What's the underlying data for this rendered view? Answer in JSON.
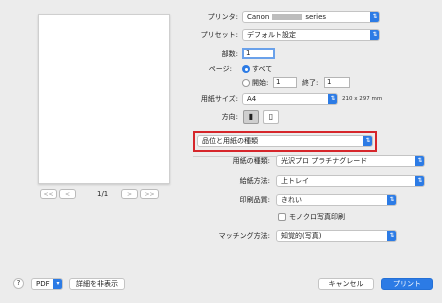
{
  "preview": {
    "page_count": "1/1",
    "nav": {
      "first": "<<",
      "prev": "<",
      "next": ">",
      "last": ">>"
    }
  },
  "settings": {
    "printer": {
      "label": "プリンタ:",
      "value_prefix": "Canon",
      "value_suffix": "series"
    },
    "preset": {
      "label": "プリセット:",
      "value": "デフォルト設定"
    },
    "copies": {
      "label": "部数:",
      "value": "1"
    },
    "pages": {
      "label": "ページ:",
      "all": "すべて",
      "from_label": "開始:",
      "from_value": "1",
      "to_label": "終了:",
      "to_value": "1"
    },
    "paper_size": {
      "label": "用紙サイズ:",
      "value": "A4",
      "dims": "210 x 297 mm"
    },
    "orientation": {
      "label": "方向:",
      "selected": "portrait"
    },
    "section_popup": {
      "value": "品位と用紙の種類"
    },
    "media_type": {
      "label": "用紙の種類:",
      "value": "光沢プロ プラチナグレード"
    },
    "paper_source": {
      "label": "給紙方法:",
      "value": "上トレイ"
    },
    "print_quality": {
      "label": "印刷品質:",
      "value": "きれい"
    },
    "grayscale": {
      "label": "モノクロ写真印刷",
      "checked": false
    },
    "color_matching": {
      "label": "マッチング方法:",
      "value": "知覚的(写真)"
    }
  },
  "footer": {
    "help": "?",
    "pdf": "PDF",
    "hide_details": "詳細を非表示",
    "cancel": "キャンセル",
    "print": "プリント"
  },
  "colors": {
    "accent": "#2c7be5",
    "highlight": "#d6262b",
    "background": "#ececec"
  }
}
